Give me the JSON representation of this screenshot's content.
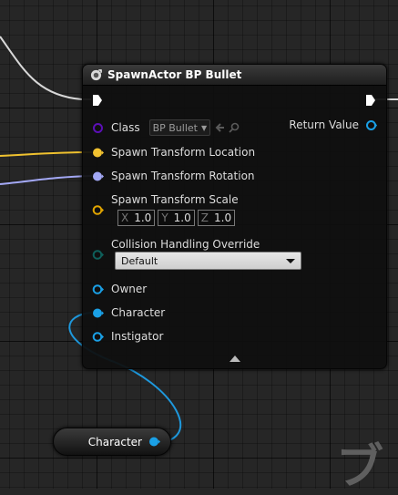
{
  "node": {
    "title": "SpawnActor BP Bullet",
    "icon": "spawn-actor-icon",
    "class_label": "Class",
    "class_value": "BP Bullet",
    "return_label": "Return Value",
    "pins": {
      "spawn_location": "Spawn Transform Location",
      "spawn_rotation": "Spawn Transform Rotation",
      "spawn_scale": "Spawn Transform Scale",
      "collision_override": "Collision Handling Override",
      "owner": "Owner",
      "character": "Character",
      "instigator": "Instigator"
    },
    "scale": [
      {
        "axis": "X",
        "value": "1.0"
      },
      {
        "axis": "Y",
        "value": "1.0"
      },
      {
        "axis": "Z",
        "value": "1.0"
      }
    ],
    "collision_value": "Default"
  },
  "variable_node": {
    "label": "Character"
  },
  "watermark": "ブ",
  "colors": {
    "background": "#262626",
    "node_body": "#0f0f0f",
    "exec_wire": "#e6e6e6",
    "vector_pin": "#f2c230",
    "rotator_pin": "#a3a8f5",
    "transform_pin": "#e0a400",
    "class_pin": "#5b0fb5",
    "enum_pin": "#0e5f5a",
    "object_pin": "#1aa0e6"
  }
}
